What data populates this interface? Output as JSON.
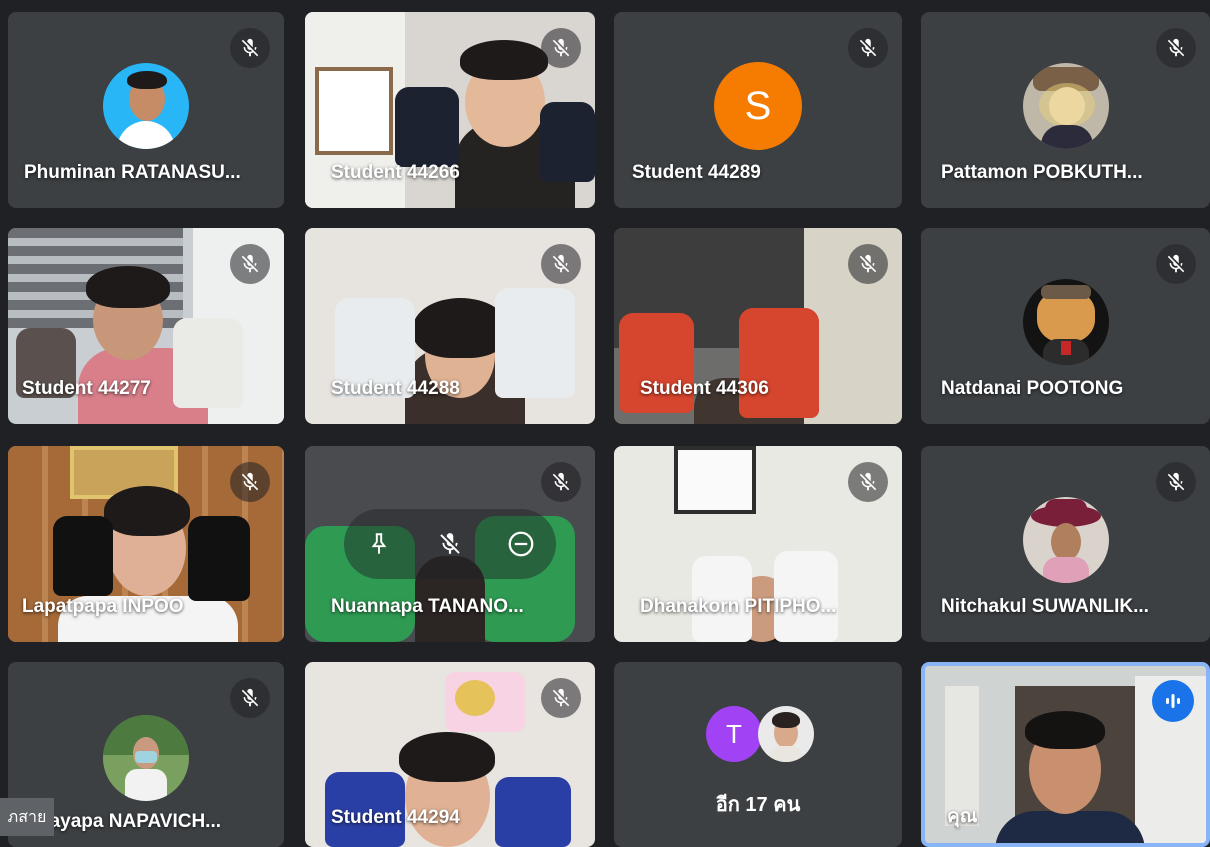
{
  "participants": [
    {
      "name": "Phuminan RATANASU...",
      "kind": "avatar"
    },
    {
      "name": "Student 44266",
      "kind": "video"
    },
    {
      "name": "Student 44289",
      "kind": "letter",
      "letter": "S",
      "color": "#f57c00"
    },
    {
      "name": "Pattamon POBKUTH...",
      "kind": "avatar"
    },
    {
      "name": "Student 44277",
      "kind": "video"
    },
    {
      "name": "Student 44288",
      "kind": "video"
    },
    {
      "name": "Student 44306",
      "kind": "video"
    },
    {
      "name": "Natdanai POOTONG",
      "kind": "avatar"
    },
    {
      "name": "Lapatpapa INPOO",
      "kind": "video"
    },
    {
      "name": "Nuannapa TANANO...",
      "kind": "video"
    },
    {
      "name": "Dhanakorn PITIPHO...",
      "kind": "video"
    },
    {
      "name": "Nitchakul SUWANLIK...",
      "kind": "avatar"
    },
    {
      "name": "nayapa NAPAVICH...",
      "kind": "avatar"
    },
    {
      "name": "Student 44294",
      "kind": "video"
    },
    {
      "name": "อีก 17 คน",
      "kind": "overflow",
      "letter": "T",
      "color": "#a142f4"
    },
    {
      "name": "คุณ",
      "kind": "self"
    }
  ],
  "overlay": {
    "caption_chip": "ภสาย"
  },
  "colors": {
    "tile_bg": "#3c4043",
    "page_bg": "#202124",
    "accent": "#1a73e8"
  },
  "icons": [
    "mic-off-icon",
    "pin-icon",
    "remove-icon",
    "audio-level-icon"
  ]
}
